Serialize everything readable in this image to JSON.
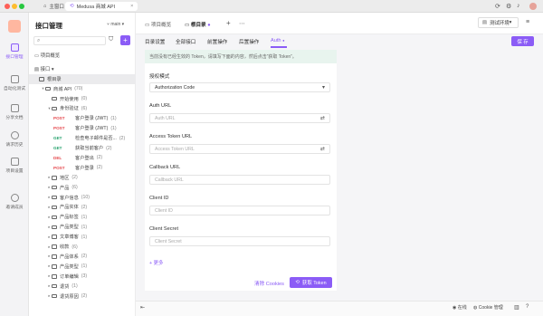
{
  "window": {
    "tab1": "主窗口",
    "tab2": "Medusa 商城 API"
  },
  "rail": {
    "items": [
      "接口管理",
      "自动化测试",
      "分享文档",
      "请求历史",
      "项目设置",
      "邀请成员"
    ]
  },
  "sidebar": {
    "title": "接口管理",
    "branch": "main",
    "search_placeholder": "",
    "overview": "项目概览",
    "section": "接口",
    "tree": [
      {
        "kind": "folder",
        "label": "根目录",
        "indent": 0,
        "sel": true,
        "caret": ""
      },
      {
        "kind": "folder",
        "label": "商城 API",
        "count": "(70)",
        "indent": 1,
        "caret": "▾"
      },
      {
        "kind": "folder",
        "label": "开始使用",
        "count": "(0)",
        "indent": 2,
        "caret": ""
      },
      {
        "kind": "folder",
        "label": "身份验证",
        "count": "(6)",
        "indent": 2,
        "caret": "▾"
      },
      {
        "kind": "api",
        "method": "POST",
        "label": "客户登录 (JWT)",
        "count": "(1)",
        "indent": 3
      },
      {
        "kind": "api",
        "method": "POST",
        "label": "客户登录 (JWT)",
        "count": "(1)",
        "indent": 3
      },
      {
        "kind": "api",
        "method": "GET",
        "label": "检查电子邮件是否...",
        "count": "(2)",
        "indent": 3
      },
      {
        "kind": "api",
        "method": "GET",
        "label": "获取当前客户",
        "count": "(2)",
        "indent": 3
      },
      {
        "kind": "api",
        "method": "DEL",
        "label": "客户登出",
        "count": "(2)",
        "indent": 3
      },
      {
        "kind": "api",
        "method": "POST",
        "label": "客户登录",
        "count": "(2)",
        "indent": 3
      },
      {
        "kind": "folder",
        "label": "地区",
        "count": "(2)",
        "indent": 2,
        "caret": "▸"
      },
      {
        "kind": "folder",
        "label": "产品",
        "count": "(6)",
        "indent": 2,
        "caret": "▸"
      },
      {
        "kind": "folder",
        "label": "客户信息",
        "count": "(10)",
        "indent": 2,
        "caret": "▸"
      },
      {
        "kind": "folder",
        "label": "产品实体",
        "count": "(2)",
        "indent": 2,
        "caret": "▸"
      },
      {
        "kind": "folder",
        "label": "产品标签",
        "count": "(1)",
        "indent": 2,
        "caret": "▸"
      },
      {
        "kind": "folder",
        "label": "产品类型",
        "count": "(1)",
        "indent": 2,
        "caret": "▸"
      },
      {
        "kind": "folder",
        "label": "文章博客",
        "count": "(1)",
        "indent": 2,
        "caret": "▸"
      },
      {
        "kind": "folder",
        "label": "收款",
        "count": "(6)",
        "indent": 2,
        "caret": "▸"
      },
      {
        "kind": "folder",
        "label": "产品体系",
        "count": "(2)",
        "indent": 2,
        "caret": "▸"
      },
      {
        "kind": "folder",
        "label": "产品类型",
        "count": "(1)",
        "indent": 2,
        "caret": "▸"
      },
      {
        "kind": "folder",
        "label": "订单编辑",
        "count": "(3)",
        "indent": 2,
        "caret": "▸"
      },
      {
        "kind": "folder",
        "label": "退货",
        "count": "(1)",
        "indent": 2,
        "caret": "▸"
      },
      {
        "kind": "folder",
        "label": "退货原因",
        "count": "(2)",
        "indent": 2,
        "caret": "▸"
      }
    ]
  },
  "main": {
    "tabs": {
      "overview": "项目概览",
      "root": "根目录"
    },
    "env": "测试环境",
    "sub_tabs": [
      "目录设置",
      "全部接口",
      "前置操作",
      "后置操作",
      "Auth"
    ],
    "save": "保 存",
    "notice": "当前没有已经生效的 Token，请填写下面的内容，然后点击“获取 Token”。",
    "form": {
      "grant_label": "授权模式",
      "grant_value": "Authorization Code",
      "auth_label": "Auth URL",
      "auth_ph": "Auth URL",
      "token_label": "Access Token URL",
      "token_ph": "Access Token URL",
      "cb_label": "Callback URL",
      "cb_ph": "Callback URL",
      "cid_label": "Client ID",
      "cid_ph": "Client ID",
      "cs_label": "Client Secret",
      "cs_ph": "Client Secret",
      "more": "更多"
    },
    "clear_cookies": "清除 Cookies",
    "get_token": "获取 Token"
  },
  "footer": {
    "online": "在线",
    "cookie": "Cookie 管理"
  }
}
